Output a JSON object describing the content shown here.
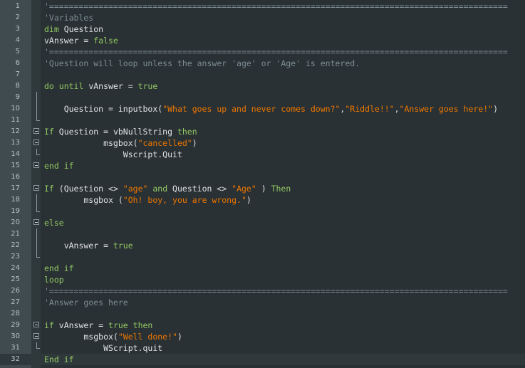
{
  "editor": {
    "language": "VBScript",
    "colors": {
      "background": "#293134",
      "gutter": "#3f4b4e",
      "comment": "#7d8c93",
      "keyword": "#93c763",
      "string": "#ec7600",
      "text": "#e0e2e4"
    },
    "lines": [
      {
        "n": "1",
        "fold": "none",
        "tokens": [
          {
            "t": "'=============================================================================================",
            "c": "comment"
          }
        ]
      },
      {
        "n": "2",
        "fold": "none",
        "tokens": [
          {
            "t": "'Variables",
            "c": "comment"
          }
        ]
      },
      {
        "n": "3",
        "fold": "none",
        "tokens": [
          {
            "t": "dim",
            "c": "keyword"
          },
          {
            "t": " Question",
            "c": "text"
          }
        ]
      },
      {
        "n": "4",
        "fold": "none",
        "tokens": [
          {
            "t": "vAnswer = ",
            "c": "text"
          },
          {
            "t": "false",
            "c": "keyword"
          }
        ]
      },
      {
        "n": "5",
        "fold": "none",
        "tokens": [
          {
            "t": "'=============================================================================================",
            "c": "comment"
          }
        ]
      },
      {
        "n": "6",
        "fold": "none",
        "tokens": [
          {
            "t": "'Question will loop unless the answer 'age' or 'Age' is entered.",
            "c": "comment"
          }
        ]
      },
      {
        "n": "7",
        "fold": "none",
        "tokens": []
      },
      {
        "n": "8",
        "fold": "none",
        "tokens": [
          {
            "t": "do until",
            "c": "keyword"
          },
          {
            "t": " vAnswer = ",
            "c": "text"
          },
          {
            "t": "true",
            "c": "keyword"
          }
        ]
      },
      {
        "n": "9",
        "fold": "vert",
        "tokens": []
      },
      {
        "n": "10",
        "fold": "vert",
        "tokens": [
          {
            "t": "    Question = inputbox(",
            "c": "text"
          },
          {
            "t": "\"What goes up and never comes down?\"",
            "c": "string"
          },
          {
            "t": ",",
            "c": "text"
          },
          {
            "t": "\"Riddle!!\"",
            "c": "string"
          },
          {
            "t": ",",
            "c": "text"
          },
          {
            "t": "\"Answer goes here!\"",
            "c": "string"
          },
          {
            "t": ")",
            "c": "text"
          }
        ]
      },
      {
        "n": "11",
        "fold": "end",
        "tokens": []
      },
      {
        "n": "12",
        "fold": "box",
        "tokens": [
          {
            "t": "If",
            "c": "keyword"
          },
          {
            "t": " Question = vbNullString ",
            "c": "text"
          },
          {
            "t": "then",
            "c": "keyword"
          }
        ]
      },
      {
        "n": "13",
        "fold": "box",
        "tokens": [
          {
            "t": "            msgbox(",
            "c": "text"
          },
          {
            "t": "\"cancelled\"",
            "c": "string"
          },
          {
            "t": ")",
            "c": "text"
          }
        ]
      },
      {
        "n": "14",
        "fold": "end",
        "tokens": [
          {
            "t": "                Wscript.Quit",
            "c": "text"
          }
        ]
      },
      {
        "n": "15",
        "fold": "box",
        "tokens": [
          {
            "t": "end if",
            "c": "keyword"
          }
        ]
      },
      {
        "n": "16",
        "fold": "none",
        "tokens": []
      },
      {
        "n": "17",
        "fold": "box",
        "tokens": [
          {
            "t": "If",
            "c": "keyword"
          },
          {
            "t": " (Question <> ",
            "c": "text"
          },
          {
            "t": "\"age\"",
            "c": "string"
          },
          {
            "t": " and ",
            "c": "keyword"
          },
          {
            "t": "Question <> ",
            "c": "text"
          },
          {
            "t": "\"Age\"",
            "c": "string"
          },
          {
            "t": " ) ",
            "c": "text"
          },
          {
            "t": "Then",
            "c": "keyword"
          }
        ]
      },
      {
        "n": "18",
        "fold": "vert",
        "tokens": [
          {
            "t": "        msgbox (",
            "c": "text"
          },
          {
            "t": "\"Oh! boy, you are wrong.\"",
            "c": "string"
          },
          {
            "t": ")",
            "c": "text"
          }
        ]
      },
      {
        "n": "19",
        "fold": "end",
        "tokens": []
      },
      {
        "n": "20",
        "fold": "box",
        "tokens": [
          {
            "t": "else",
            "c": "keyword"
          }
        ]
      },
      {
        "n": "21",
        "fold": "vert",
        "tokens": []
      },
      {
        "n": "22",
        "fold": "vert",
        "tokens": [
          {
            "t": "    vAnswer = ",
            "c": "text"
          },
          {
            "t": "true",
            "c": "keyword"
          }
        ]
      },
      {
        "n": "23",
        "fold": "end",
        "tokens": []
      },
      {
        "n": "24",
        "fold": "none",
        "tokens": [
          {
            "t": "end if",
            "c": "keyword"
          }
        ]
      },
      {
        "n": "25",
        "fold": "none",
        "tokens": [
          {
            "t": "loop",
            "c": "keyword"
          }
        ]
      },
      {
        "n": "26",
        "fold": "none",
        "tokens": [
          {
            "t": "'=============================================================================================",
            "c": "comment"
          }
        ]
      },
      {
        "n": "27",
        "fold": "none",
        "tokens": [
          {
            "t": "'Answer goes here",
            "c": "comment"
          }
        ]
      },
      {
        "n": "28",
        "fold": "none",
        "tokens": []
      },
      {
        "n": "29",
        "fold": "box",
        "tokens": [
          {
            "t": "if",
            "c": "keyword"
          },
          {
            "t": " vAnswer = ",
            "c": "text"
          },
          {
            "t": "true",
            "c": "keyword"
          },
          {
            "t": " then",
            "c": "keyword"
          }
        ]
      },
      {
        "n": "30",
        "fold": "box",
        "tokens": [
          {
            "t": "        msgbox(",
            "c": "text"
          },
          {
            "t": "\"Well done!\"",
            "c": "string"
          },
          {
            "t": ")",
            "c": "text"
          }
        ]
      },
      {
        "n": "31",
        "fold": "end",
        "tokens": [
          {
            "t": "            WScript.quit",
            "c": "text"
          }
        ]
      },
      {
        "n": "32",
        "fold": "none",
        "current": true,
        "tokens": [
          {
            "t": "End if",
            "c": "keyword"
          }
        ]
      }
    ]
  }
}
